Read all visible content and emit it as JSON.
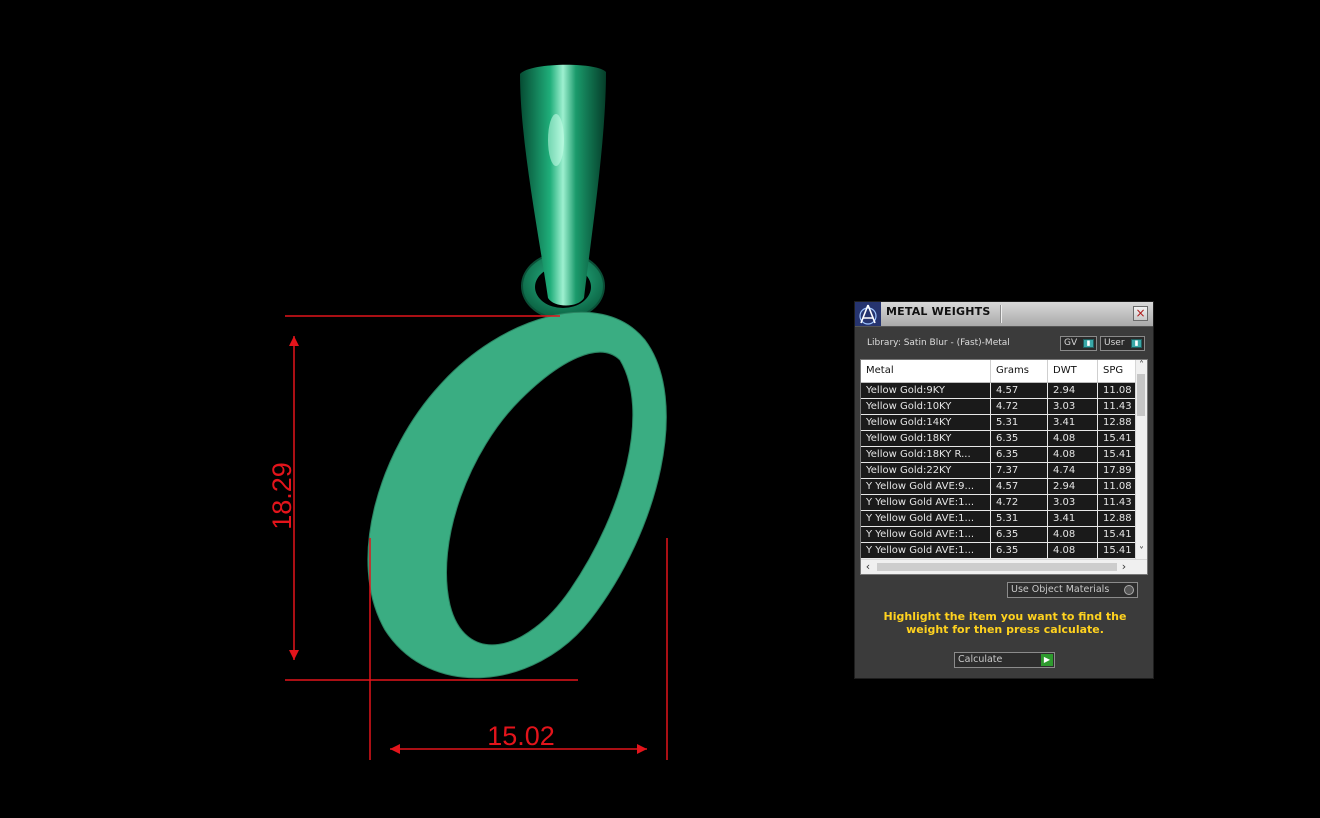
{
  "viewport": {
    "dimension_height": "18.29",
    "dimension_width": "15.02",
    "object_color": "#3aad82",
    "bail_color": "#0e7a52",
    "dimension_color": "#e3141b"
  },
  "panel": {
    "title": "METAL WEIGHTS",
    "close_icon": "×",
    "library_label": "Library: Satin Blur - (Fast)-Metal",
    "toggle_gv": "GV",
    "toggle_user": "User",
    "columns": [
      "Metal",
      "Grams",
      "DWT",
      "SPG"
    ],
    "rows": [
      [
        "Yellow Gold:9KY",
        "4.57",
        "2.94",
        "11.08"
      ],
      [
        "Yellow Gold:10KY",
        "4.72",
        "3.03",
        "11.43"
      ],
      [
        "Yellow Gold:14KY",
        "5.31",
        "3.41",
        "12.88"
      ],
      [
        "Yellow Gold:18KY",
        "6.35",
        "4.08",
        "15.41"
      ],
      [
        "Yellow Gold:18KY R...",
        "6.35",
        "4.08",
        "15.41"
      ],
      [
        "Yellow Gold:22KY",
        "7.37",
        "4.74",
        "17.89"
      ],
      [
        "Y Yellow Gold AVE:9...",
        "4.57",
        "2.94",
        "11.08"
      ],
      [
        "Y Yellow Gold AVE:1...",
        "4.72",
        "3.03",
        "11.43"
      ],
      [
        "Y Yellow Gold AVE:1...",
        "5.31",
        "3.41",
        "12.88"
      ],
      [
        "Y Yellow Gold AVE:1...",
        "6.35",
        "4.08",
        "15.41"
      ],
      [
        "Y Yellow Gold AVE:1...",
        "6.35",
        "4.08",
        "15.41"
      ]
    ],
    "use_object_materials": "Use Object Materials",
    "hint": "Highlight the item you want to find the weight for then press calculate.",
    "calculate_label": "Calculate",
    "accent_hint_color": "#ffd21f"
  }
}
